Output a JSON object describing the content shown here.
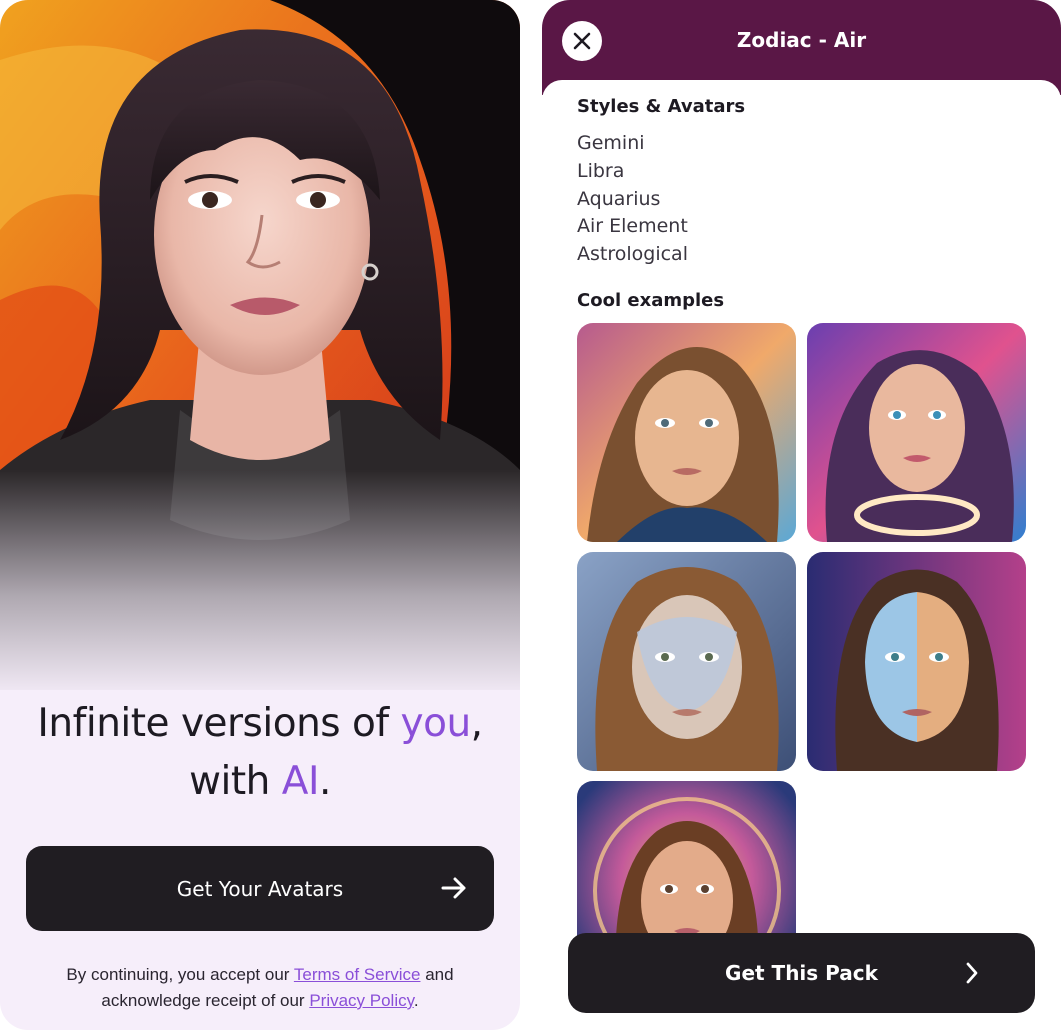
{
  "onboarding": {
    "headline": {
      "part1": "Infinite versions of ",
      "accent1": "you",
      "part2": ",",
      "part3": "with ",
      "accent2": "AI",
      "part4": "."
    },
    "cta_label": "Get Your Avatars",
    "cta_icon": "arrow-right-icon",
    "legal": {
      "line1_prefix": "By continuing, you accept our ",
      "terms_link": "Terms of Service",
      "line1_suffix": " and",
      "line2_prefix": "acknowledge receipt of our ",
      "privacy_link": "Privacy Policy",
      "line2_suffix": "."
    },
    "accent_color": "#8a4fd8"
  },
  "pack": {
    "title": "Zodiac - Air",
    "close_icon": "close-icon",
    "header_color": "#5a1746",
    "styles_heading": "Styles & Avatars",
    "styles": [
      "Gemini",
      "Libra",
      "Aquarius",
      "Air Element",
      "Astrological"
    ],
    "examples_heading": "Cool examples",
    "examples": [
      {
        "name": "example-1"
      },
      {
        "name": "example-2"
      },
      {
        "name": "example-3"
      },
      {
        "name": "example-4"
      },
      {
        "name": "example-5"
      }
    ],
    "cta_label": "Get This Pack",
    "cta_icon": "chevron-right-icon"
  }
}
